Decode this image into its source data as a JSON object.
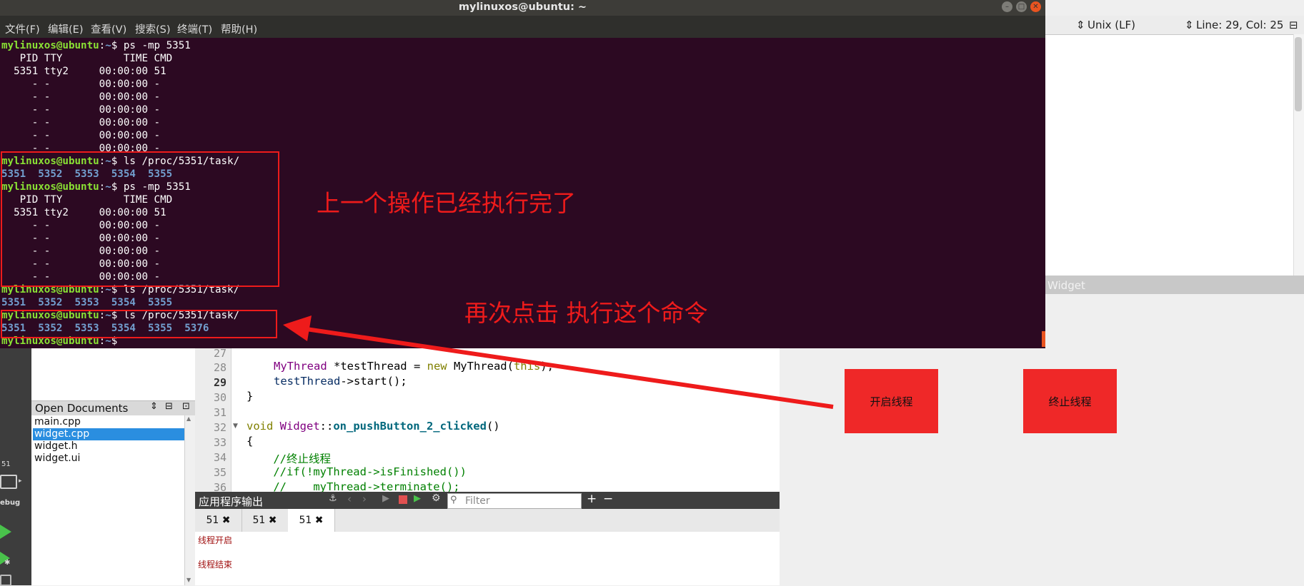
{
  "terminal": {
    "title": "mylinuxos@ubuntu: ~",
    "menu": [
      "文件(F)",
      "编辑(E)",
      "查看(V)",
      "搜索(S)",
      "终端(T)",
      "帮助(H)"
    ],
    "prompt_user": "mylinuxos@ubuntu",
    "prompt_sep": ":",
    "prompt_path": "~",
    "prompt_end": "$",
    "lines": [
      {
        "type": "prompt",
        "cmd": " ps -mp 5351"
      },
      {
        "type": "text",
        "text": "   PID TTY          TIME CMD"
      },
      {
        "type": "text",
        "text": "  5351 tty2     00:00:00 51"
      },
      {
        "type": "text",
        "text": "     - -        00:00:00 -"
      },
      {
        "type": "text",
        "text": "     - -        00:00:00 -"
      },
      {
        "type": "text",
        "text": "     - -        00:00:00 -"
      },
      {
        "type": "text",
        "text": "     - -        00:00:00 -"
      },
      {
        "type": "text",
        "text": "     - -        00:00:00 -"
      },
      {
        "type": "text",
        "text": "     - -        00:00:00 -"
      },
      {
        "type": "prompt",
        "cmd": " ls /proc/5351/task/"
      },
      {
        "type": "blue",
        "text": "5351  5352  5353  5354  5355"
      },
      {
        "type": "prompt",
        "cmd": " ps -mp 5351"
      },
      {
        "type": "text",
        "text": "   PID TTY          TIME CMD"
      },
      {
        "type": "text",
        "text": "  5351 tty2     00:00:00 51"
      },
      {
        "type": "text",
        "text": "     - -        00:00:00 -"
      },
      {
        "type": "text",
        "text": "     - -        00:00:00 -"
      },
      {
        "type": "text",
        "text": "     - -        00:00:00 -"
      },
      {
        "type": "text",
        "text": "     - -        00:00:00 -"
      },
      {
        "type": "text",
        "text": "     - -        00:00:00 -"
      },
      {
        "type": "prompt",
        "cmd": " ls /proc/5351/task/"
      },
      {
        "type": "blue",
        "text": "5351  5352  5353  5354  5355"
      },
      {
        "type": "prompt",
        "cmd": " ls /proc/5351/task/"
      },
      {
        "type": "blue",
        "text": "5351  5352  5353  5354  5355  5376"
      },
      {
        "type": "prompt",
        "cmd": ""
      }
    ]
  },
  "annotations": {
    "note1": "上一个操作已经执行完了",
    "note2": "再次点击 执行这个命令"
  },
  "qt": {
    "editor_strip": {
      "encoding": "Unix (LF)",
      "position": "Line: 29, Col: 25"
    },
    "preview_title": "Widget",
    "buttons": {
      "start": "开启线程",
      "stop": "终止线程"
    },
    "mode_labels": {
      "run_count": "51",
      "debug": "ebug"
    },
    "open_documents_title": "Open Documents",
    "open_documents": [
      "main.cpp",
      "widget.cpp",
      "widget.h",
      "widget.ui"
    ],
    "code": {
      "line_numbers": [
        "27",
        "28",
        "29",
        "30",
        "31",
        "32",
        "33",
        "34",
        "35",
        "36"
      ],
      "l28_type": "MyThread",
      "l28_var": " *testThread = ",
      "l28_new": "new",
      "l28_ctor": " MyThread(",
      "l28_this": "this",
      "l28_end": ");",
      "l29_var": "testThread",
      "l29_rest": "->start();",
      "l30": "}",
      "l32_void": "void",
      "l32_cls": " Widget",
      "l32_sep": "::",
      "l32_fn": "on_pushButton_2_clicked",
      "l32_end": "()",
      "l33": "{",
      "l34": "    //终止线程",
      "l35": "    //if(!myThread->isFinished())",
      "l36": "    //    myThread->terminate();"
    },
    "output_title": "应用程序输出",
    "filter_placeholder": "Filter",
    "output_tabs": [
      "51",
      "51",
      "51"
    ],
    "output_lines": [
      "线程开启",
      "线程结束"
    ],
    "colors": {
      "button_red": "#ef2828",
      "annotation_red": "#ee1b1b",
      "terminal_bg": "#2c0922"
    }
  }
}
